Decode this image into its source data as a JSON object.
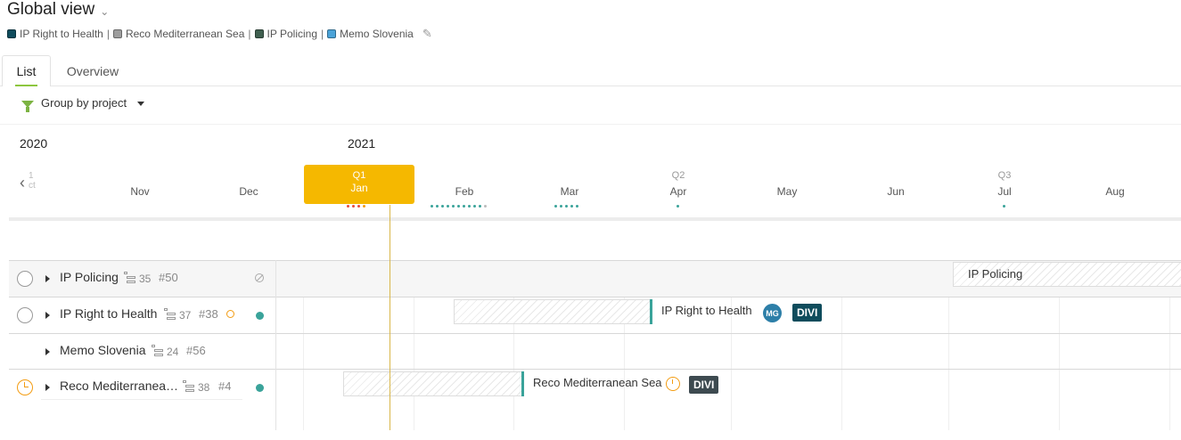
{
  "header": {
    "title": "Global view",
    "legend": [
      {
        "label": "IP Right to Health",
        "color": "#0f4c5c"
      },
      {
        "label": "Reco Mediterranean Sea",
        "color": "#9e9e9e"
      },
      {
        "label": "IP Policing",
        "color": "#3f5f4f"
      },
      {
        "label": "Memo Slovenia",
        "color": "#4ba3d8"
      }
    ],
    "legend_separator": "|"
  },
  "tabs": [
    {
      "label": "List",
      "active": true
    },
    {
      "label": "Overview",
      "active": false
    }
  ],
  "toolbar": {
    "group_label": "Group by project"
  },
  "timeline": {
    "years": [
      "2020",
      "2021"
    ],
    "faded_month": "1\nct",
    "months": [
      "Nov",
      "Dec",
      "Jan",
      "Feb",
      "Mar",
      "Apr",
      "May",
      "Jun",
      "Jul",
      "Aug"
    ],
    "quarters": {
      "q1": "Q1",
      "q2": "Q2",
      "q3": "Q3"
    },
    "current_quarter": "Q1",
    "current_month": "Jan",
    "highlight_color": "#f5b800"
  },
  "rows": [
    {
      "name": "IP Policing",
      "count": "35",
      "number": "#50"
    },
    {
      "name": "IP Right to Health",
      "count": "37",
      "number": "#38"
    },
    {
      "name": "Memo Slovenia",
      "count": "24",
      "number": "#56"
    },
    {
      "name": "Reco Mediterranea…",
      "count": "38",
      "number": "#4"
    }
  ],
  "bars": {
    "ip_policing": {
      "label": "IP Policing"
    },
    "ip_right": {
      "label": "IP Right to Health",
      "avatar": "MG",
      "tag": "DIVI",
      "tag_color": "#0f4c5c"
    },
    "reco": {
      "label": "Reco Mediterranean Sea",
      "tag": "DIVI",
      "tag_color": "#3d4a50"
    }
  },
  "colors": {
    "status_green": "#3aa39a",
    "status_orange": "#f39c12",
    "accent_green": "#8dc63f"
  }
}
